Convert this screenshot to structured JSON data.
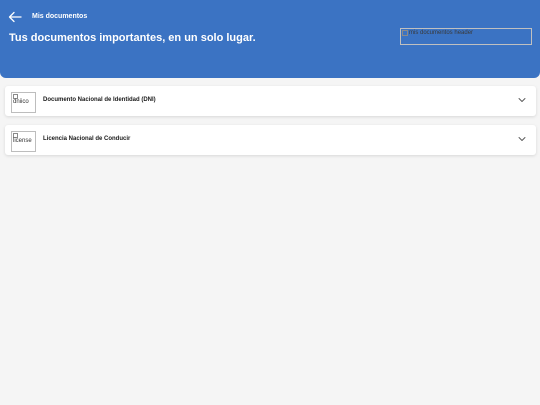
{
  "header": {
    "nav_title": "Mis documentos",
    "hero_title": "Tus documentos importantes, en un solo lugar.",
    "header_image_alt": "mis documentos header",
    "back_icon": "arrow-left-icon",
    "background_color": "#3b73c3"
  },
  "documents": [
    {
      "icon_alt": "dniico",
      "label": "Documento Nacional de Identidad (DNI)",
      "chevron_icon": "chevron-down-icon"
    },
    {
      "icon_alt": "license",
      "label": "Licencia Nacional de Conducir",
      "chevron_icon": "chevron-down-icon"
    }
  ],
  "page": {
    "background_color": "#f5f5f5"
  }
}
